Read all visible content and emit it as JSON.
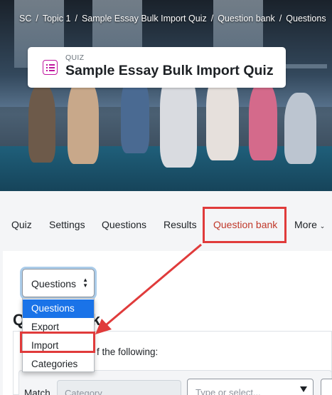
{
  "breadcrumb": [
    "SC",
    "Topic 1",
    "Sample Essay Bulk Import Quiz",
    "Question bank",
    "Questions"
  ],
  "header": {
    "label": "QUIZ",
    "title": "Sample Essay Bulk Import Quiz"
  },
  "nav": {
    "tabs": [
      "Quiz",
      "Settings",
      "Questions",
      "Results",
      "Question bank",
      "More"
    ],
    "active": "Question bank"
  },
  "select": {
    "value": "Questions"
  },
  "dropdown": {
    "options": [
      "Questions",
      "Export",
      "Import",
      "Categories"
    ],
    "selected": "Questions"
  },
  "page": {
    "heading_fragment": "Q",
    "heading_fragment2": "nk",
    "filter_text": "f the following:"
  },
  "filter": {
    "match_label": "Match",
    "category_placeholder": "Category",
    "type_placeholder": "Type or select..."
  },
  "colors": {
    "accent": "#c0392b",
    "highlight": "#e03b3b",
    "selected": "#1a73e8"
  }
}
